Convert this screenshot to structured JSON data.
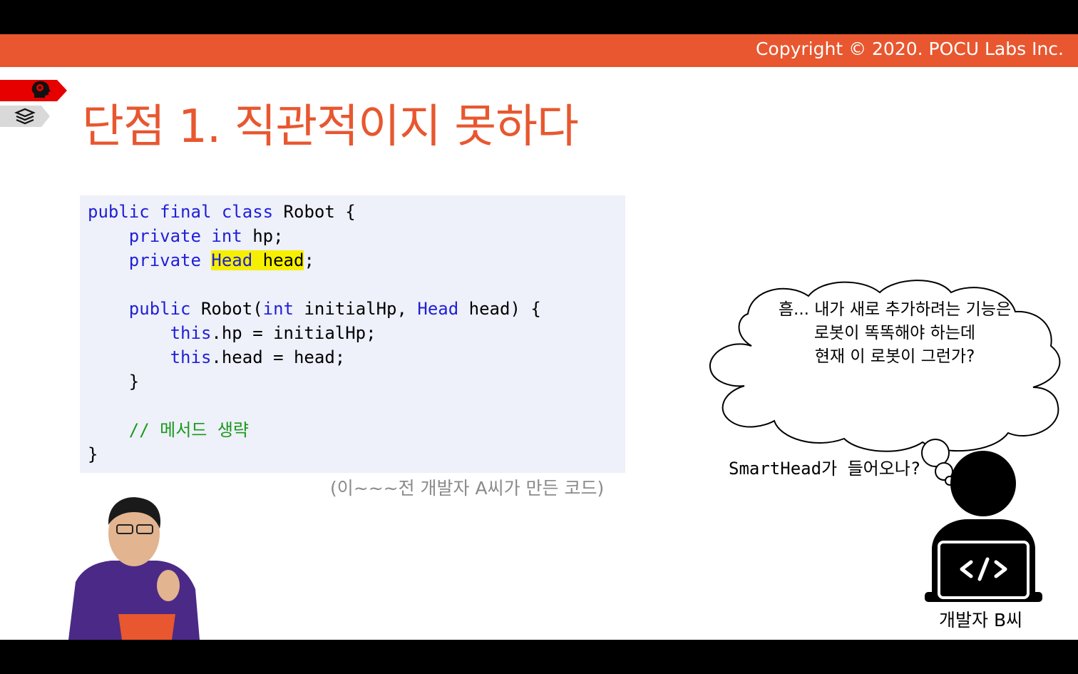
{
  "header": {
    "copyright": "Copyright © 2020. POCU Labs Inc."
  },
  "nav": {
    "items": [
      {
        "icon": "brain-head-icon",
        "color": "#e60000"
      },
      {
        "icon": "book-stack-icon",
        "color": "#d9d9d9"
      }
    ]
  },
  "slide": {
    "title": "단점 1. 직관적이지 못하다",
    "code_lines": [
      [
        {
          "t": "public final class",
          "c": "kw"
        },
        {
          "t": " Robot {"
        }
      ],
      [
        {
          "t": "    "
        },
        {
          "t": "private int",
          "c": "kw"
        },
        {
          "t": " hp;"
        }
      ],
      [
        {
          "t": "    "
        },
        {
          "t": "private",
          "c": "kw"
        },
        {
          "t": " "
        },
        {
          "t": "Head",
          "c": "kw hl"
        },
        {
          "t": " ",
          "c": "hl"
        },
        {
          "t": "head",
          "c": "hl"
        },
        {
          "t": ";"
        }
      ],
      [],
      [
        {
          "t": "    "
        },
        {
          "t": "public",
          "c": "kw"
        },
        {
          "t": " Robot("
        },
        {
          "t": "int",
          "c": "kw"
        },
        {
          "t": " initialHp, "
        },
        {
          "t": "Head",
          "c": "kw"
        },
        {
          "t": " head) {"
        }
      ],
      [
        {
          "t": "        "
        },
        {
          "t": "this",
          "c": "kw"
        },
        {
          "t": ".hp = initialHp;"
        }
      ],
      [
        {
          "t": "        "
        },
        {
          "t": "this",
          "c": "kw"
        },
        {
          "t": ".head = head;"
        }
      ],
      [
        {
          "t": "    }"
        }
      ],
      [],
      [
        {
          "t": "    "
        },
        {
          "t": "// 메서드 생략",
          "c": "cm"
        }
      ],
      [
        {
          "t": "}"
        }
      ]
    ],
    "caption": "(이~~~전 개발자 A씨가 만든 코드)",
    "thought_lines": [
      "흠... 내가 새로 추가하려는 기능은",
      "로봇이 똑똑해야 하는데",
      "현재 이 로봇이 그런가?"
    ],
    "smarthead_text": "SmartHead가 들어오나?",
    "developer_label": "개발자 B씨",
    "developer_icon": "developer-laptop-icon"
  },
  "colors": {
    "accent": "#e8572f",
    "keyword": "#1f1fd6",
    "comment": "#199a19",
    "highlight": "#f6f000",
    "code_bg": "#eef0fa"
  }
}
